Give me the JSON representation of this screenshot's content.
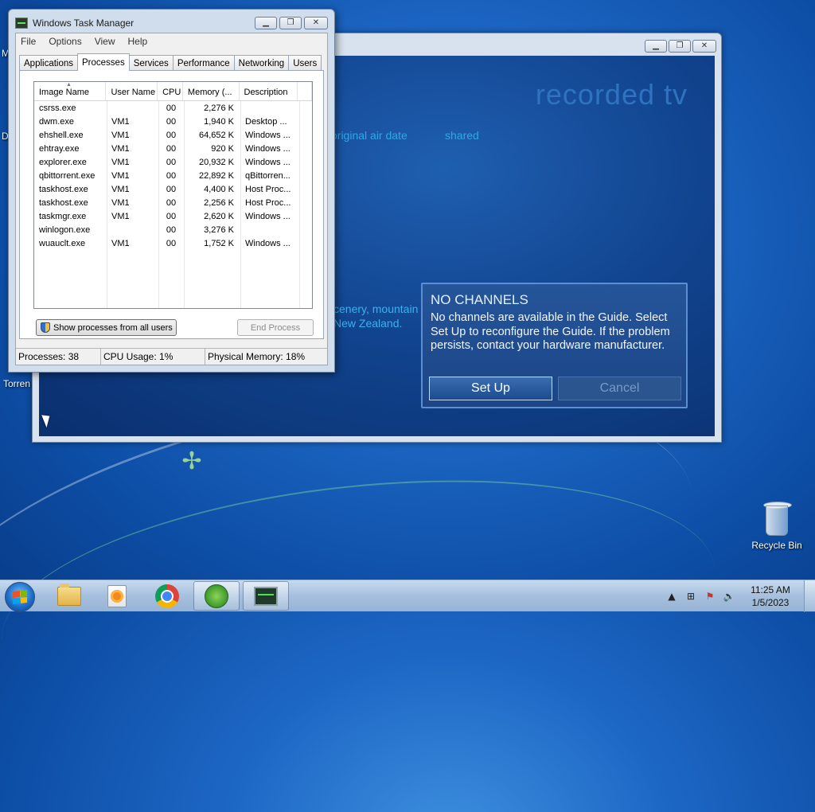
{
  "desktop": {
    "left_labels": [
      "M",
      "D",
      "Torren"
    ],
    "recycle_bin_label": "Recycle Bin"
  },
  "media_center": {
    "title": "recorded tv",
    "columns": [
      "original air date",
      "shared"
    ],
    "description_lines": [
      "cenery, mountain",
      "New Zealand."
    ],
    "dialog": {
      "heading": "NO CHANNELS",
      "message": "No channels are available in the Guide. Select Set Up to reconfigure the Guide. If the problem persists, contact your hardware manufacturer.",
      "setup_label": "Set Up",
      "cancel_label": "Cancel"
    }
  },
  "task_manager": {
    "title": "Windows Task Manager",
    "menu": [
      "File",
      "Options",
      "View",
      "Help"
    ],
    "tabs": [
      "Applications",
      "Processes",
      "Services",
      "Performance",
      "Networking",
      "Users"
    ],
    "active_tab": "Processes",
    "columns": [
      "Image Name",
      "User Name",
      "CPU",
      "Memory (...",
      "Description"
    ],
    "rows": [
      {
        "name": "csrss.exe",
        "user": "",
        "cpu": "00",
        "memory": "2,276 K",
        "description": ""
      },
      {
        "name": "dwm.exe",
        "user": "VM1",
        "cpu": "00",
        "memory": "1,940 K",
        "description": "Desktop ..."
      },
      {
        "name": "ehshell.exe",
        "user": "VM1",
        "cpu": "00",
        "memory": "64,652 K",
        "description": "Windows ..."
      },
      {
        "name": "ehtray.exe",
        "user": "VM1",
        "cpu": "00",
        "memory": "920 K",
        "description": "Windows ..."
      },
      {
        "name": "explorer.exe",
        "user": "VM1",
        "cpu": "00",
        "memory": "20,932 K",
        "description": "Windows ..."
      },
      {
        "name": "qbittorrent.exe",
        "user": "VM1",
        "cpu": "00",
        "memory": "22,892 K",
        "description": "qBittorren..."
      },
      {
        "name": "taskhost.exe",
        "user": "VM1",
        "cpu": "00",
        "memory": "4,400 K",
        "description": "Host Proc..."
      },
      {
        "name": "taskhost.exe",
        "user": "VM1",
        "cpu": "00",
        "memory": "2,256 K",
        "description": "Host Proc..."
      },
      {
        "name": "taskmgr.exe",
        "user": "VM1",
        "cpu": "00",
        "memory": "2,620 K",
        "description": "Windows ..."
      },
      {
        "name": "winlogon.exe",
        "user": "",
        "cpu": "00",
        "memory": "3,276 K",
        "description": ""
      },
      {
        "name": "wuauclt.exe",
        "user": "VM1",
        "cpu": "00",
        "memory": "1,752 K",
        "description": "Windows ..."
      }
    ],
    "show_all_label": "Show processes from all users",
    "end_process_label": "End Process",
    "status": {
      "processes": "Processes: 38",
      "cpu": "CPU Usage: 1%",
      "memory": "Physical Memory: 18%"
    }
  },
  "taskbar": {
    "time": "11:25 AM",
    "date": "1/5/2023",
    "items": [
      "folder-icon",
      "media-player-icon",
      "chrome-icon",
      "media-center-icon",
      "task-manager-icon"
    ]
  }
}
